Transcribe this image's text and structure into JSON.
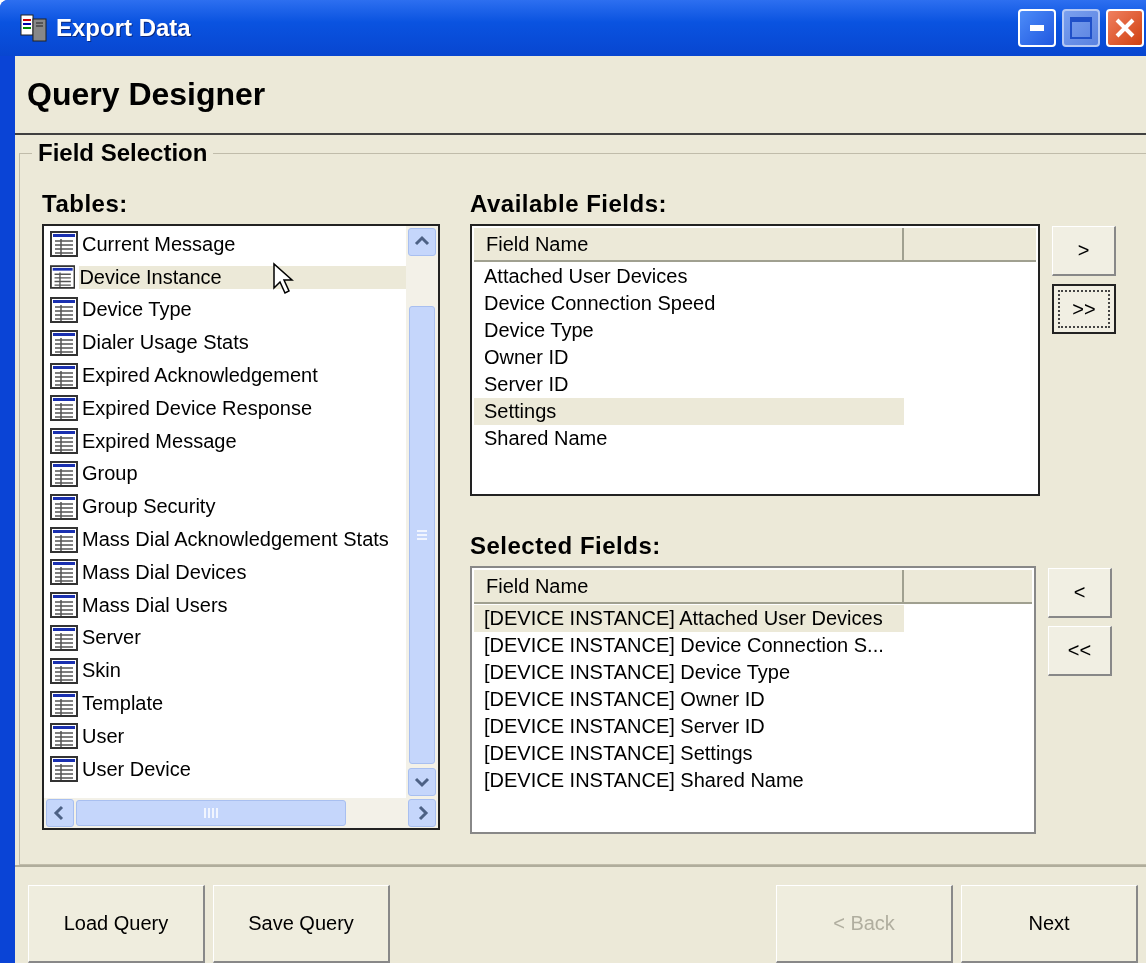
{
  "window": {
    "title": "Export Data",
    "controls": [
      {
        "kind": "minimize",
        "disabled": false
      },
      {
        "kind": "maximize",
        "disabled": true
      },
      {
        "kind": "close",
        "disabled": false
      }
    ]
  },
  "header": {
    "title": "Query Designer"
  },
  "group": {
    "title": "Field Selection"
  },
  "tables": {
    "label": "Tables:",
    "items": [
      {
        "name": "Current Message",
        "selected": false
      },
      {
        "name": "Device Instance",
        "selected": true
      },
      {
        "name": "Device Type",
        "selected": false
      },
      {
        "name": "Dialer Usage Stats",
        "selected": false
      },
      {
        "name": "Expired Acknowledgement",
        "selected": false
      },
      {
        "name": "Expired Device Response",
        "selected": false
      },
      {
        "name": "Expired Message",
        "selected": false
      },
      {
        "name": "Group",
        "selected": false
      },
      {
        "name": "Group Security",
        "selected": false
      },
      {
        "name": "Mass Dial Acknowledgement Stats",
        "selected": false
      },
      {
        "name": "Mass Dial Devices",
        "selected": false
      },
      {
        "name": "Mass Dial Users",
        "selected": false
      },
      {
        "name": "Server",
        "selected": false
      },
      {
        "name": "Skin",
        "selected": false
      },
      {
        "name": "Template",
        "selected": false
      },
      {
        "name": "User",
        "selected": false
      },
      {
        "name": "User Device",
        "selected": false
      }
    ]
  },
  "available_fields": {
    "label": "Available Fields:",
    "columns": [
      "Field Name"
    ],
    "rows": [
      {
        "name": "Attached User Devices",
        "selected": false
      },
      {
        "name": "Device Connection Speed",
        "selected": false
      },
      {
        "name": "Device Type",
        "selected": false
      },
      {
        "name": "Owner ID",
        "selected": false
      },
      {
        "name": "Server ID",
        "selected": false
      },
      {
        "name": "Settings",
        "selected": true
      },
      {
        "name": "Shared Name",
        "selected": false
      }
    ],
    "buttons": [
      {
        "label": ">",
        "focused": false
      },
      {
        "label": ">>",
        "focused": true
      }
    ]
  },
  "selected_fields": {
    "label": "Selected Fields:",
    "columns": [
      "Field Name"
    ],
    "rows": [
      {
        "name": "[DEVICE INSTANCE] Attached User Devices",
        "selected": true
      },
      {
        "name": "[DEVICE INSTANCE] Device Connection S...",
        "selected": false
      },
      {
        "name": "[DEVICE INSTANCE] Device Type",
        "selected": false
      },
      {
        "name": "[DEVICE INSTANCE] Owner ID",
        "selected": false
      },
      {
        "name": "[DEVICE INSTANCE] Server ID",
        "selected": false
      },
      {
        "name": "[DEVICE INSTANCE] Settings",
        "selected": false
      },
      {
        "name": "[DEVICE INSTANCE] Shared Name",
        "selected": false
      }
    ],
    "buttons": [
      {
        "label": "<",
        "focused": false
      },
      {
        "label": "<<",
        "focused": false
      }
    ]
  },
  "footer": {
    "left": [
      {
        "label": "Load Query",
        "disabled": false
      },
      {
        "label": "Save Query",
        "disabled": false
      }
    ],
    "right": [
      {
        "label": "< Back",
        "disabled": true
      },
      {
        "label": "Next",
        "disabled": false
      }
    ]
  }
}
